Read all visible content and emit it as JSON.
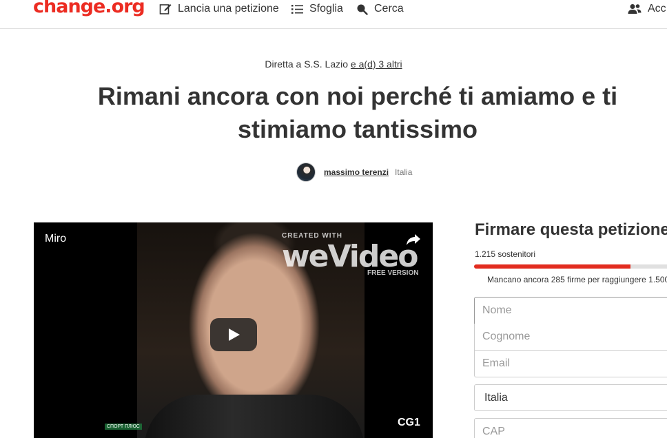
{
  "header": {
    "logo": "change.org",
    "nav": {
      "start_petition": "Lancia una petizione",
      "browse": "Sfoglia",
      "search": "Cerca",
      "account": "Acc"
    }
  },
  "petition": {
    "directed_to": "Diretta a S.S. Lazio",
    "directed_more": "e a(d) 3 altri",
    "title": "Rimani ancora con noi perché ti amiamo e ti stimiamo tantissimo",
    "author_name": "massimo terenzi",
    "author_country": "Italia"
  },
  "video": {
    "title": "Miro",
    "watermark_top": "CREATED WITH",
    "watermark": "weVideo",
    "watermark_bottom": "FREE VERSION",
    "channel": "CG1",
    "sport_tag": "СПОРТ ПЛЮС"
  },
  "sign": {
    "title": "Firmare questa petizione",
    "supporters": "1.215 sostenitori",
    "progress_fraction": 0.81,
    "goal_text": "Mancano ancora 285 firme per raggiungere 1.500",
    "name_placeholder": "Nome",
    "surname_placeholder": "Cognome",
    "email_placeholder": "Email",
    "country_value": "Italia",
    "zip_placeholder": "CAP"
  },
  "colors": {
    "brand": "#ec2c22",
    "progress": "#e22c1f"
  }
}
